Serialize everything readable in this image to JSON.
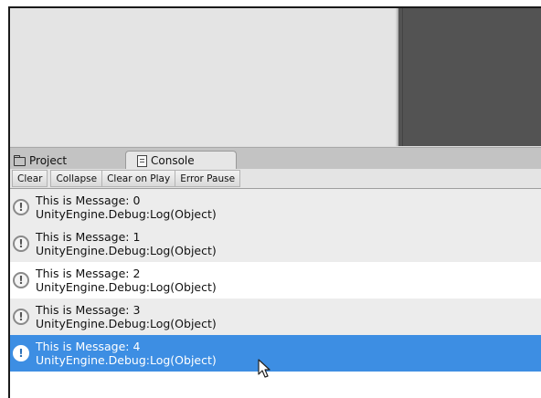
{
  "tabs": {
    "project": {
      "label": "Project",
      "icon": "folder-icon"
    },
    "console": {
      "label": "Console",
      "icon": "console-icon"
    }
  },
  "toolbar": {
    "clear": "Clear",
    "collapse": "Collapse",
    "clear_on_play": "Clear on Play",
    "error_pause": "Error Pause"
  },
  "messages": [
    {
      "line1": "This is Message: 0",
      "line2": "UnityEngine.Debug:Log(Object)"
    },
    {
      "line1": "This is Message: 1",
      "line2": "UnityEngine.Debug:Log(Object)"
    },
    {
      "line1": "This is Message: 2",
      "line2": "UnityEngine.Debug:Log(Object)"
    },
    {
      "line1": "This is Message: 3",
      "line2": "UnityEngine.Debug:Log(Object)"
    },
    {
      "line1": "This is Message: 4",
      "line2": "UnityEngine.Debug:Log(Object)",
      "selected": true
    }
  ],
  "colors": {
    "selection": "#3d8ee3",
    "game_view": "#535353",
    "panel": "#e4e4e4"
  }
}
